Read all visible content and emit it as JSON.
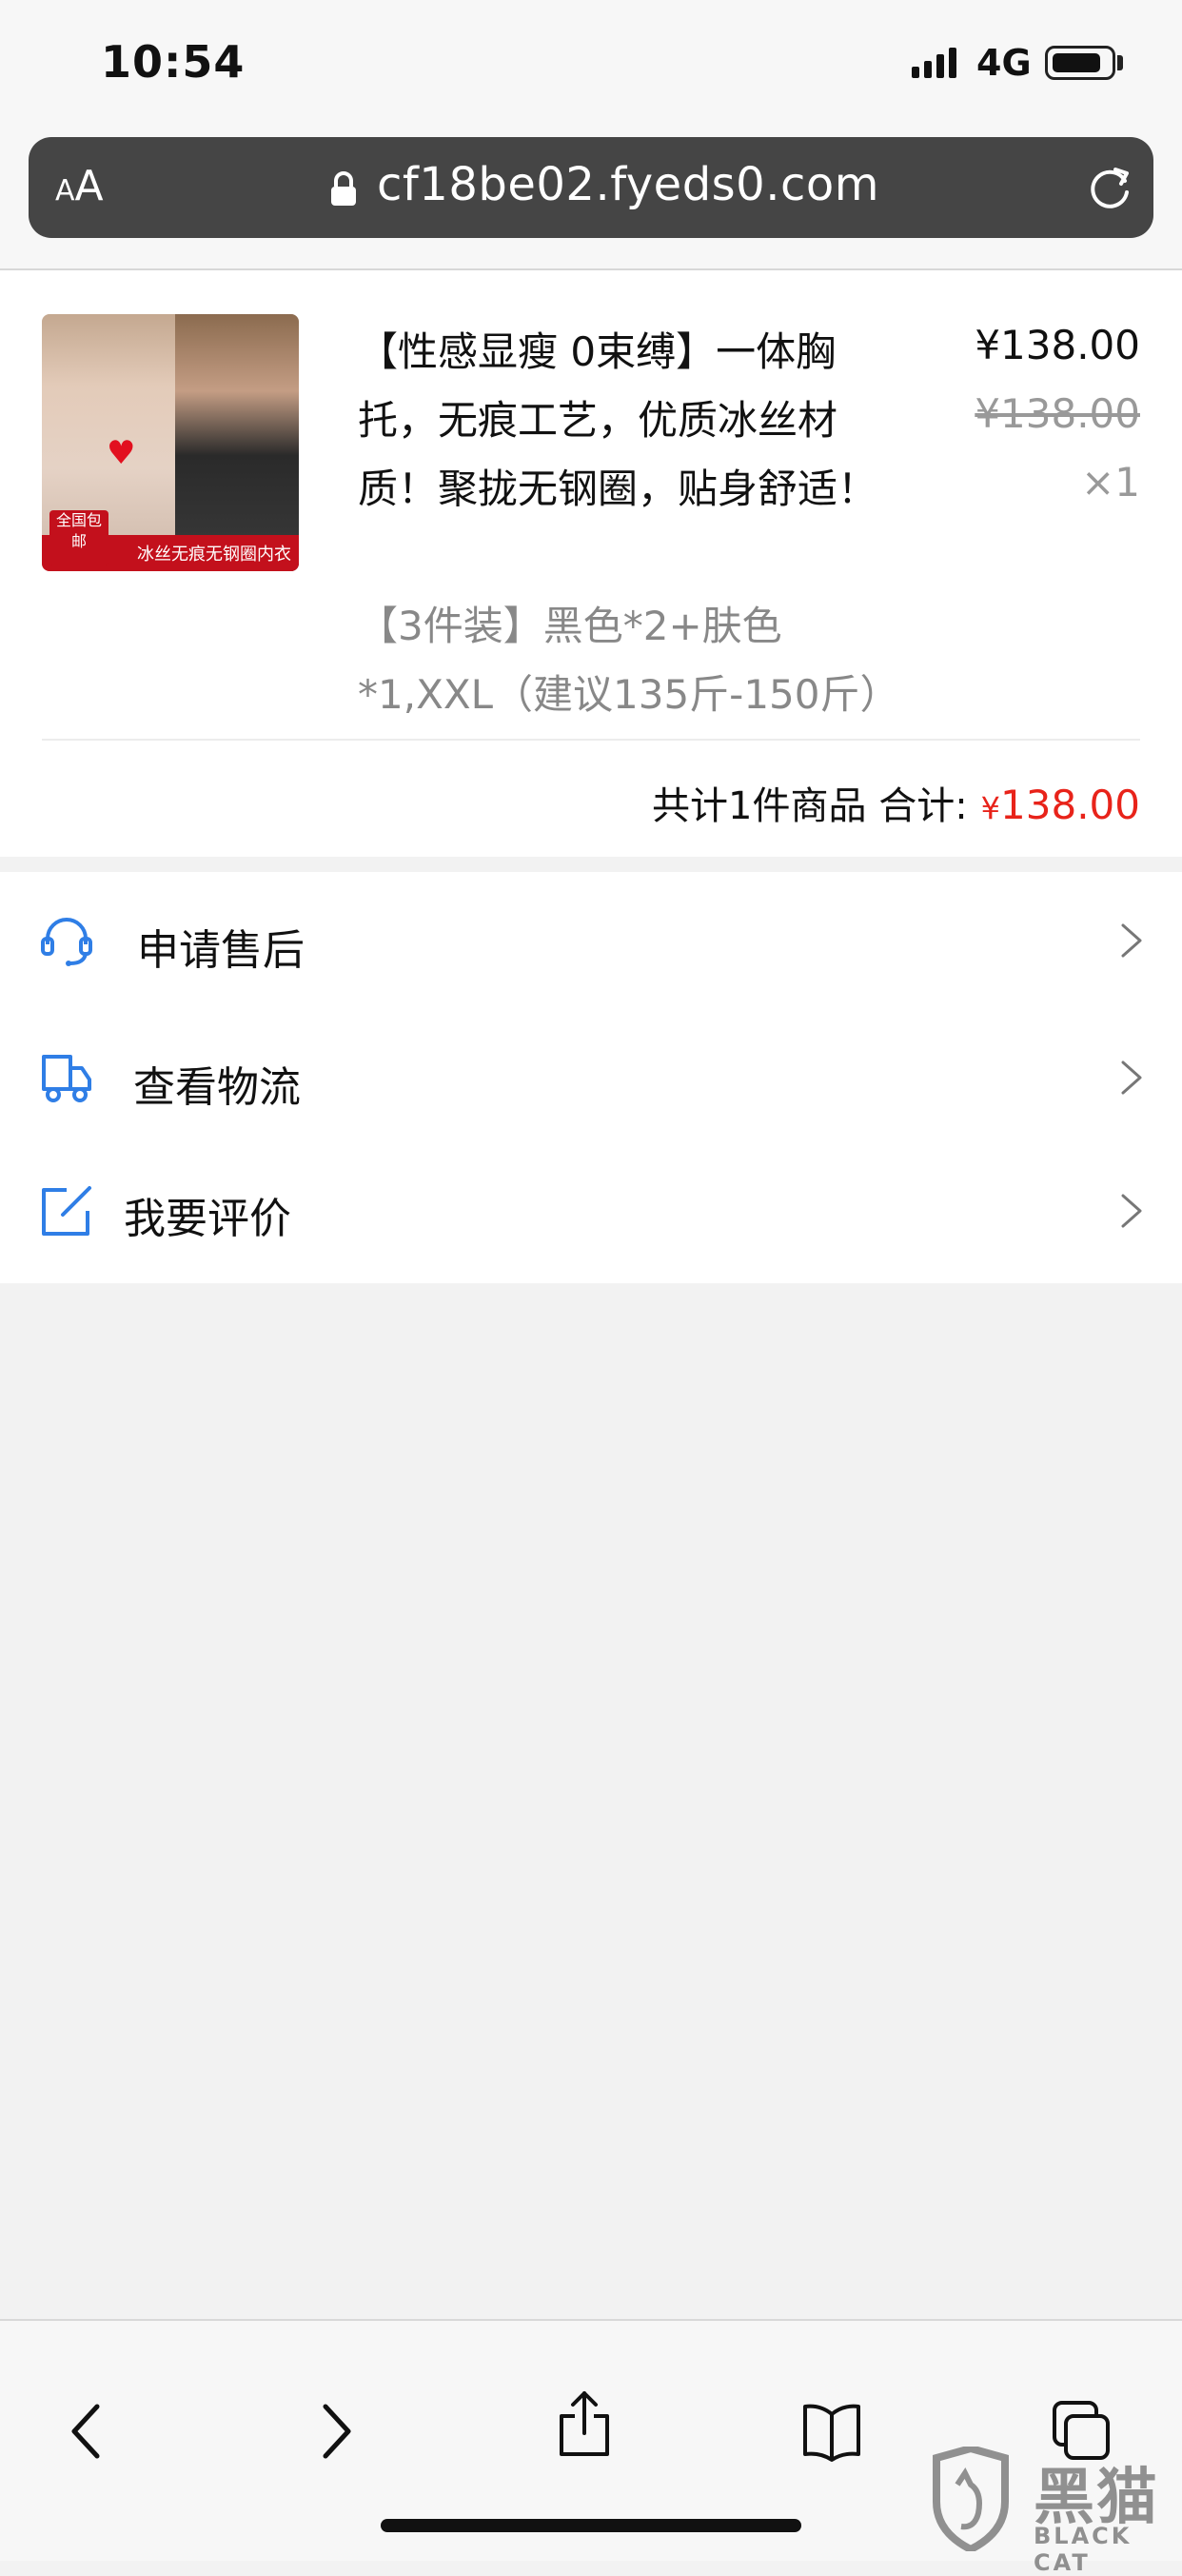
{
  "status_bar": {
    "time": "10:54",
    "network": "4G",
    "icons": [
      "signal-icon",
      "battery-icon"
    ]
  },
  "browser": {
    "text_size_label_small": "A",
    "text_size_label_large": "A",
    "url": "cf18be02.fyeds0.com",
    "icons": [
      "lock-icon",
      "reload-icon"
    ]
  },
  "order": {
    "product": {
      "title": "【性感显瘦 0束缚】一体胸托，无痕工艺，优质冰丝材质！聚拢无钢圈，贴身舒适！",
      "spec": "【3件装】黑色*2+肤色*1,XXL（建议135斤-150斤）",
      "price": "¥138.00",
      "original_price": "¥138.00",
      "quantity": "×1",
      "thumbnail": {
        "badge": "全国包邮",
        "tagline": "冰丝无痕无钢圈内衣"
      }
    },
    "summary": {
      "count_text": "共计1件商品 合计:",
      "currency": "¥",
      "total": "138.00"
    },
    "accent_color": "#e8231a"
  },
  "menu": {
    "items": [
      {
        "label": "申请售后",
        "icon": "headset-icon"
      },
      {
        "label": "查看物流",
        "icon": "delivery-truck-icon"
      },
      {
        "label": "我要评价",
        "icon": "edit-review-icon"
      }
    ],
    "icon_color": "#2f7ee6"
  },
  "toolbar": {
    "icons": [
      "back-icon",
      "forward-icon",
      "share-icon",
      "bookmarks-icon",
      "tabs-icon"
    ]
  },
  "watermark": {
    "name_cn": "黑猫",
    "name_en": "BLACK CAT"
  }
}
